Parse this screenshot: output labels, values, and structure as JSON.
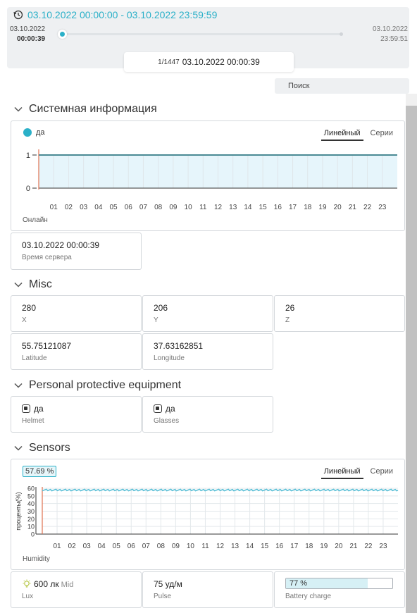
{
  "header": {
    "range_title": "03.10.2022 00:00:00 - 03.10.2022 23:59:59",
    "start_date": "03.10.2022",
    "start_time": "00:00:39",
    "end_date": "03.10.2022",
    "end_time": "23:59:51",
    "frame_count": "1/1447",
    "frame_timestamp": "03.10.2022 00:00:39",
    "accent_color": "#2ab0c8"
  },
  "search": {
    "label": "Поиск"
  },
  "sections": {
    "system": "Системная информация",
    "misc": "Misc",
    "ppe": "Personal protective equipment",
    "sensors": "Sensors"
  },
  "tabs": {
    "line": "Линейный",
    "series": "Серии"
  },
  "online_chart": {
    "legend": "да",
    "footer": "Онлайн",
    "y_ticks": [
      "1",
      "0"
    ],
    "x_ticks": [
      "01",
      "02",
      "03",
      "04",
      "05",
      "06",
      "07",
      "08",
      "09",
      "10",
      "11",
      "12",
      "13",
      "14",
      "15",
      "16",
      "17",
      "18",
      "19",
      "20",
      "21",
      "22",
      "23"
    ]
  },
  "server_time": {
    "value": "03.10.2022 00:00:39",
    "label": "Время сервера"
  },
  "misc": {
    "x": {
      "value": "280",
      "label": "X"
    },
    "y": {
      "value": "206",
      "label": "Y"
    },
    "z": {
      "value": "26",
      "label": "Z"
    },
    "latitude": {
      "value": "55.75121087",
      "label": "Latitude"
    },
    "longitude": {
      "value": "37.63162851",
      "label": "Longitude"
    }
  },
  "ppe": {
    "helmet": {
      "value": "да",
      "label": "Helmet"
    },
    "glasses": {
      "value": "да",
      "label": "Glasses"
    }
  },
  "humidity_chart": {
    "current": "57.69 %",
    "ylabel": "проценты(%)",
    "y_ticks": [
      "60",
      "50",
      "40",
      "30",
      "20",
      "10",
      "0"
    ],
    "x_ticks": [
      "01",
      "02",
      "03",
      "04",
      "05",
      "06",
      "07",
      "08",
      "09",
      "10",
      "11",
      "12",
      "13",
      "14",
      "15",
      "16",
      "17",
      "18",
      "19",
      "20",
      "21",
      "22",
      "23"
    ],
    "footer": "Humidity"
  },
  "sensors": {
    "lux": {
      "value": "600 лк",
      "level": "Mid",
      "label": "Lux"
    },
    "pulse": {
      "value": "75 уд/м",
      "label": "Pulse"
    },
    "battery": {
      "value": "77 %",
      "fraction": 0.77,
      "label": "Battery charge"
    }
  },
  "chart_data": [
    {
      "type": "area",
      "title": "",
      "xlabel": "Онлайн",
      "ylabel": "",
      "x": [
        0,
        24
      ],
      "series": [
        {
          "name": "да",
          "values": [
            1,
            1
          ]
        }
      ],
      "ylim": [
        0,
        1
      ],
      "grid": true
    },
    {
      "type": "line",
      "title": "",
      "xlabel": "Humidity",
      "ylabel": "проценты(%)",
      "x": [
        0,
        24
      ],
      "series": [
        {
          "values": [
            57.7,
            57.7
          ]
        }
      ],
      "ylim": [
        0,
        60
      ],
      "grid": true
    }
  ]
}
